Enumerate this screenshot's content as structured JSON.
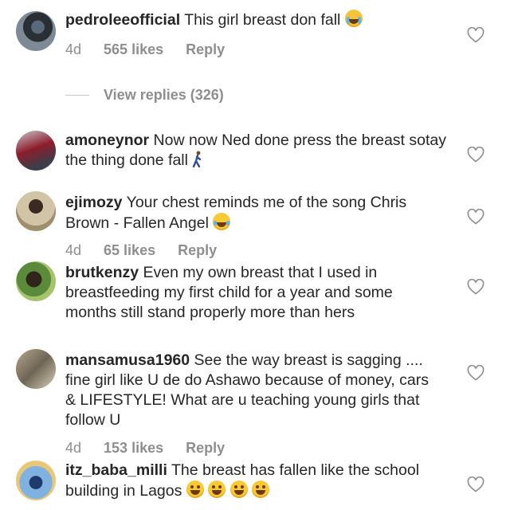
{
  "comments": [
    {
      "username": "pedroleeofficial",
      "text": "This girl breast don fall",
      "time": "4d",
      "likes": "565 likes",
      "reply": "Reply",
      "emoji": "crying-face"
    },
    {
      "username": "amoneynor",
      "text": "Now now Ned done press the breast sotay the thing done fall",
      "emoji": "walking-person"
    },
    {
      "username": "ejimozy",
      "text": "Your chest reminds me of the song Chris Brown - Fallen Angel",
      "time": "4d",
      "likes": "65 likes",
      "reply": "Reply",
      "emoji": "tears-of-joy-face"
    },
    {
      "username": "brutkenzy",
      "text": "Even my own breast that I used in breastfeeding my first child for a year and some months still stand properly more than hers"
    },
    {
      "username": "mansamusa1960",
      "text": "See the way breast is sagging .... fine girl like U de do Ashawo because of money, cars & LIFESTYLE! What are u teaching young girls that follow U",
      "time": "4d",
      "likes": "153 likes",
      "reply": "Reply"
    },
    {
      "username": "itz_baba_milli",
      "text": "The breast has fallen like the school building in Lagos",
      "emoji": "grinning-face"
    }
  ],
  "view_replies": "View replies (326)",
  "icons": {
    "heart": "heart-outline-icon"
  },
  "colors": {
    "text": "#262626",
    "muted": "#8e8e8e"
  }
}
